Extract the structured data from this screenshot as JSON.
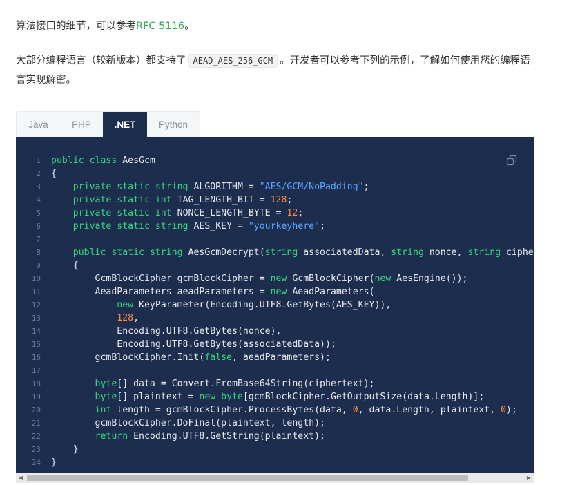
{
  "intro": {
    "p1_text": "算法接口的细节，可以参考",
    "p1_link": "RFC 5116",
    "p1_end": "。",
    "p2_before": "大部分编程语言（较新版本）都支持了",
    "p2_code": "AEAD_AES_256_GCM",
    "p2_after": "。开发者可以参考下列的示例，了解如何使用您的编程语言实现解密。"
  },
  "tabs": [
    {
      "label": "Java",
      "active": false
    },
    {
      "label": "PHP",
      "active": false
    },
    {
      "label": ".NET",
      "active": true
    },
    {
      "label": "Python",
      "active": false
    }
  ],
  "colors": {
    "code_background": "#1d2d4d",
    "keyword": "#35d67f",
    "string": "#58a6ff",
    "number": "#ff8c3a",
    "link": "#2dad5a"
  },
  "code_lines": [
    [
      [
        "kw",
        "public class"
      ],
      [
        "t",
        " AesGcm"
      ]
    ],
    [
      [
        "t",
        "{"
      ]
    ],
    [
      [
        "t",
        "    "
      ],
      [
        "kw",
        "private static string"
      ],
      [
        "t",
        " ALGORITHM = "
      ],
      [
        "str",
        "\"AES/GCM/NoPadding\""
      ],
      [
        "t",
        ";"
      ]
    ],
    [
      [
        "t",
        "    "
      ],
      [
        "kw",
        "private static int"
      ],
      [
        "t",
        " TAG_LENGTH_BIT = "
      ],
      [
        "num",
        "128"
      ],
      [
        "t",
        ";"
      ]
    ],
    [
      [
        "t",
        "    "
      ],
      [
        "kw",
        "private static int"
      ],
      [
        "t",
        " NONCE_LENGTH_BYTE = "
      ],
      [
        "num",
        "12"
      ],
      [
        "t",
        ";"
      ]
    ],
    [
      [
        "t",
        "    "
      ],
      [
        "kw",
        "private static string"
      ],
      [
        "t",
        " AES_KEY = "
      ],
      [
        "str",
        "\"yourkeyhere\""
      ],
      [
        "t",
        ";"
      ]
    ],
    [],
    [
      [
        "t",
        "    "
      ],
      [
        "kw",
        "public static string"
      ],
      [
        "t",
        " AesGcmDecrypt("
      ],
      [
        "kw",
        "string"
      ],
      [
        "t",
        " associatedData, "
      ],
      [
        "kw",
        "string"
      ],
      [
        "t",
        " nonce, "
      ],
      [
        "kw",
        "string"
      ],
      [
        "t",
        " ciphertext)"
      ]
    ],
    [
      [
        "t",
        "    {"
      ]
    ],
    [
      [
        "t",
        "        GcmBlockCipher gcmBlockCipher = "
      ],
      [
        "kw",
        "new"
      ],
      [
        "t",
        " GcmBlockCipher("
      ],
      [
        "kw",
        "new"
      ],
      [
        "t",
        " AesEngine());"
      ]
    ],
    [
      [
        "t",
        "        AeadParameters aeadParameters = "
      ],
      [
        "kw",
        "new"
      ],
      [
        "t",
        " AeadParameters("
      ]
    ],
    [
      [
        "t",
        "            "
      ],
      [
        "kw",
        "new"
      ],
      [
        "t",
        " KeyParameter(Encoding.UTF8.GetBytes(AES_KEY)),"
      ]
    ],
    [
      [
        "t",
        "            "
      ],
      [
        "num",
        "128"
      ],
      [
        "t",
        ","
      ]
    ],
    [
      [
        "t",
        "            Encoding.UTF8.GetBytes(nonce),"
      ]
    ],
    [
      [
        "t",
        "            Encoding.UTF8.GetBytes(associatedData));"
      ]
    ],
    [
      [
        "t",
        "        gcmBlockCipher.Init("
      ],
      [
        "kw",
        "false"
      ],
      [
        "t",
        ", aeadParameters);"
      ]
    ],
    [],
    [
      [
        "t",
        "        "
      ],
      [
        "kw",
        "byte"
      ],
      [
        "t",
        "[] data = Convert.FromBase64String(ciphertext);"
      ]
    ],
    [
      [
        "t",
        "        "
      ],
      [
        "kw",
        "byte"
      ],
      [
        "t",
        "[] plaintext = "
      ],
      [
        "kw",
        "new"
      ],
      [
        "t",
        " "
      ],
      [
        "kw",
        "byte"
      ],
      [
        "t",
        "[gcmBlockCipher.GetOutputSize(data.Length)];"
      ]
    ],
    [
      [
        "t",
        "        "
      ],
      [
        "kw",
        "int"
      ],
      [
        "t",
        " length = gcmBlockCipher.ProcessBytes(data, "
      ],
      [
        "num",
        "0"
      ],
      [
        "t",
        ", data.Length, plaintext, "
      ],
      [
        "num",
        "0"
      ],
      [
        "t",
        ");"
      ]
    ],
    [
      [
        "t",
        "        gcmBlockCipher.DoFinal(plaintext, length);"
      ]
    ],
    [
      [
        "t",
        "        "
      ],
      [
        "kw",
        "return"
      ],
      [
        "t",
        " Encoding.UTF8.GetString(plaintext);"
      ]
    ],
    [
      [
        "t",
        "    }"
      ]
    ],
    [
      [
        "t",
        "}"
      ]
    ]
  ],
  "scrollbar": {
    "left_arrow": "◀",
    "right_arrow": "▶"
  },
  "icons": {
    "copy": "copy-icon"
  }
}
